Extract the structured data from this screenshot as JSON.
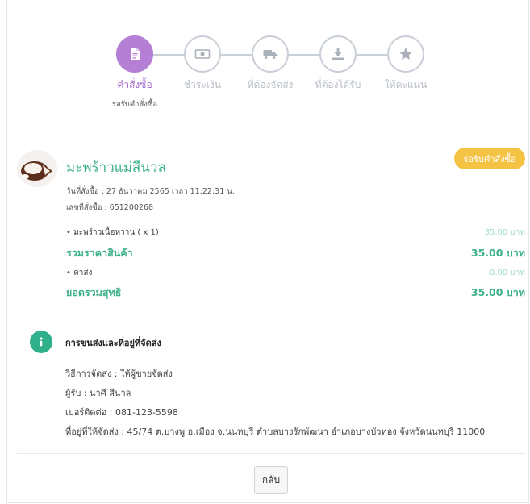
{
  "stepper": {
    "steps": [
      {
        "label": "คำสั่งซื้อ",
        "icon": "document-icon",
        "active": true,
        "sub": "รอรับคำสั่งซื้อ"
      },
      {
        "label": "ชำระเงิน",
        "icon": "banknote-icon",
        "active": false
      },
      {
        "label": "ที่ต้องจัดส่ง",
        "icon": "truck-icon",
        "active": false
      },
      {
        "label": "ที่ต้องได้รับ",
        "icon": "download-tray-icon",
        "active": false
      },
      {
        "label": "ให้คะแนน",
        "icon": "star-icon",
        "active": false
      }
    ],
    "active_color": "#b57fd6",
    "inactive_color": "#c9cfd6"
  },
  "order": {
    "shop_name": "มะพร้าวแม่สีนวล",
    "status_badge": "รอรับคำสั่งซื้อ",
    "order_date": "วันที่สั่งซื้อ : 27 ธันวาคม 2565 เวลา 11:22:31 น.",
    "order_number": "เลขที่สั่งซื้อ : 651200268",
    "items": [
      {
        "name": "• มะพร้าวเนื้อหวาน ( x 1)",
        "price": "35.00 บาท"
      }
    ],
    "subtotal_label": "รวมราคาสินค้า",
    "subtotal_value": "35.00 บาท",
    "shipping_label": "• ค่าส่ง",
    "shipping_value": "0.00 บาท",
    "net_label": "ยอดรวมสุทธิ",
    "net_value": "35.00 บาท",
    "accent_color": "#3db08c",
    "badge_color": "#f5c344"
  },
  "shipping": {
    "title": "การขนส่งและที่อยู่ที่จัดส่ง",
    "method": "วิธีการจัดส่ง : ให้ผู้ขายจัดส่ง",
    "recipient": "ผู้รับ : นาศี สีนาล",
    "phone": "เบอร์ติดต่อ : 081-123-5598",
    "address": "ที่อยู่ที่ให้จัดส่ง : 45/74 ต.บางพู อ.เมือง จ.นนทบุรี ตำบลบางรักพัฒนา อำเภอบางบัวทอง จังหวัดนนทบุรี 11000"
  },
  "actions": {
    "back_label": "กลับ"
  }
}
